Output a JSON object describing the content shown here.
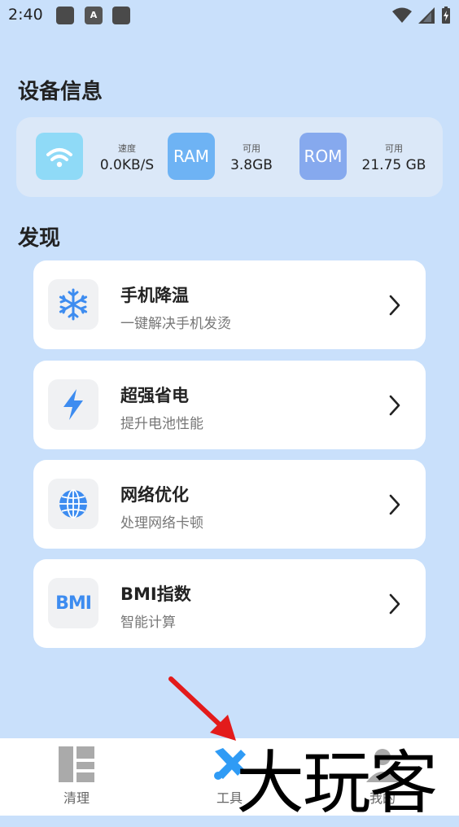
{
  "status_bar": {
    "time": "2:40",
    "notif_badge": "A"
  },
  "device_section": {
    "title": "设备信息",
    "wifi_icon": "wifi-icon",
    "speed_label": "速度",
    "speed_value": "0.0KB/S",
    "ram_label_icon": "RAM",
    "ram_label": "可用",
    "ram_value": "3.8GB",
    "rom_label_icon": "ROM",
    "rom_label": "可用",
    "rom_value": "21.75 GB"
  },
  "discover_section": {
    "title": "发现",
    "items": [
      {
        "title": "手机降温",
        "subtitle": "一键解决手机发烫",
        "icon": "snowflake-icon"
      },
      {
        "title": "超强省电",
        "subtitle": "提升电池性能",
        "icon": "lightning-icon"
      },
      {
        "title": "网络优化",
        "subtitle": "处理网络卡顿",
        "icon": "globe-icon"
      },
      {
        "title": "BMI指数",
        "subtitle": "智能计算",
        "icon": "bmi-icon",
        "icon_text": "BMI"
      }
    ]
  },
  "bottom_nav": {
    "items": [
      {
        "label": "清理",
        "icon": "clean-icon"
      },
      {
        "label": "工具",
        "icon": "tools-icon"
      },
      {
        "label": "我的",
        "icon": "profile-icon"
      }
    ]
  },
  "watermark": {
    "text": "大玩客"
  },
  "colors": {
    "background": "#c9e0fb",
    "accent_blue": "#3d8cf0",
    "wifi_tile": "#8fdaf7",
    "ram_tile": "#6eb3f4",
    "rom_tile": "#86a9ee",
    "arrow_red": "#e31b1b"
  }
}
